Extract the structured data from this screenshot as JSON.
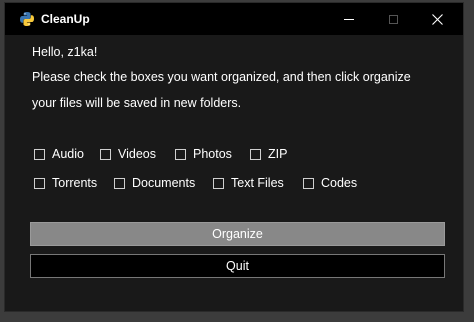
{
  "window": {
    "title": "CleanUp",
    "controls": {
      "minimize": "minimize",
      "maximize": "maximize",
      "close": "close"
    }
  },
  "greeting": "Hello, z1ka!",
  "instructions": [
    "Please check the boxes you want organized, and then click organize",
    "your files will be saved in new folders."
  ],
  "checkboxes": [
    {
      "label": "Audio",
      "checked": false
    },
    {
      "label": "Videos",
      "checked": false
    },
    {
      "label": "Photos",
      "checked": false
    },
    {
      "label": "ZIP",
      "checked": false
    },
    {
      "label": "Torrents",
      "checked": false
    },
    {
      "label": "Documents",
      "checked": false
    },
    {
      "label": "Text Files",
      "checked": false
    },
    {
      "label": "Codes",
      "checked": false
    }
  ],
  "buttons": {
    "organize": "Organize",
    "quit": "Quit"
  },
  "colors": {
    "background": "#191919",
    "titlebar": "#000000",
    "organize_button": "#888888",
    "quit_button": "#000000",
    "text": "#ffffff"
  }
}
